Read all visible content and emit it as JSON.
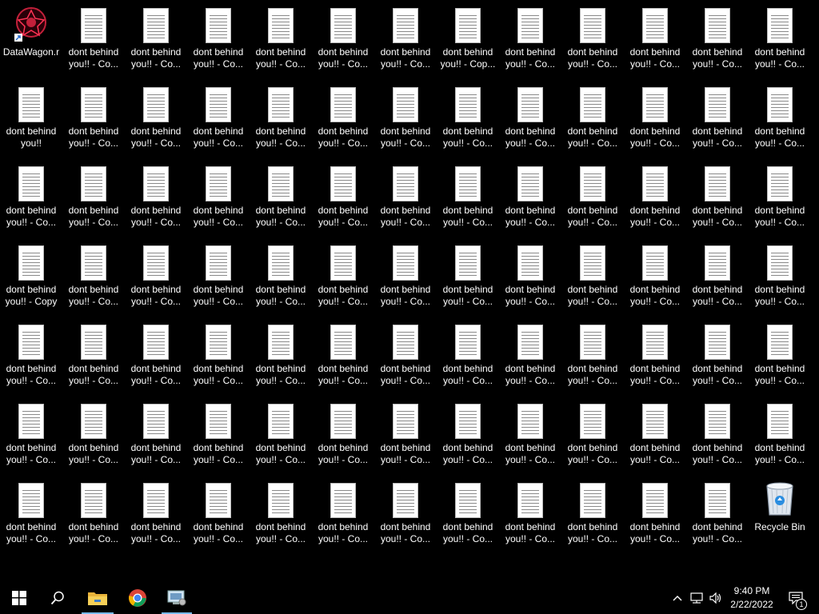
{
  "desktop": {
    "shortcut_label": "DataWagon.r",
    "special_label": "dont behind you!!",
    "copy_label": "dont behind you!! - Copy",
    "file_label": "dont behind you!! - Co...",
    "file_label_first_row_col8": "dont behind you!! - Cop...",
    "recycle_bin_label": "Recycle Bin"
  },
  "taskbar": {
    "start_icon": "windows-start-icon",
    "search_icon": "search-icon",
    "pinned": [
      "file-explorer-icon",
      "chrome-icon",
      "control-panel-icon"
    ]
  },
  "tray": {
    "time": "9:40 PM",
    "date": "2/22/2022",
    "notifications_count": "1",
    "icons": [
      "chevron-up-icon",
      "network-icon",
      "volume-icon",
      "notification-icon"
    ]
  },
  "colors": {
    "background": "#000000",
    "taskbar": "#000000",
    "active_underline": "#76b9ed"
  }
}
